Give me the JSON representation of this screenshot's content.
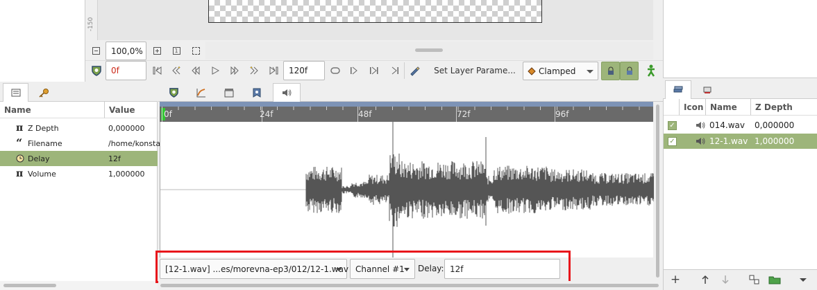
{
  "canvas": {
    "ruler_label": "-150",
    "zoom_value": "100,0%"
  },
  "toolbar": {
    "current_frame": "0f",
    "end_frame": "120f",
    "set_layer_params_label": "Set Layer Parame...",
    "interpolation": "Clamped"
  },
  "params_panel": {
    "col_name": "Name",
    "col_value": "Value",
    "rows": [
      {
        "icon": "pi-icon",
        "name": "Z Depth",
        "value": "0,000000"
      },
      {
        "icon": "quote-icon",
        "name": "Filename",
        "value": "/home/konsta"
      },
      {
        "icon": "clock-icon",
        "name": "Delay",
        "value": "12f"
      },
      {
        "icon": "pi-icon",
        "name": "Volume",
        "value": "1,000000"
      }
    ]
  },
  "timeline": {
    "ticks": [
      "0f",
      "24f",
      "48f",
      "72f",
      "96f"
    ]
  },
  "sound_panel": {
    "file_select": "[12-1.wav] ...es/morevna-ep3/012/12-1.wav",
    "channel_select": "Channel #1",
    "delay_label": "Delay:",
    "delay_value": "12f"
  },
  "layers_panel": {
    "col_icon": "Icon",
    "col_name": "Name",
    "col_zdepth": "Z Depth",
    "rows": [
      {
        "name": "014.wav",
        "zdepth": "0,000000",
        "selected": false
      },
      {
        "name": "12-1.wav",
        "zdepth": "1,000000",
        "selected": true
      }
    ]
  },
  "colors": {
    "selection": "#9db57a",
    "timebar": "#7d93b6",
    "ruler": "#6a6a6a",
    "highlight_box": "#e8161b",
    "frame_text": "#cc2a1a"
  }
}
